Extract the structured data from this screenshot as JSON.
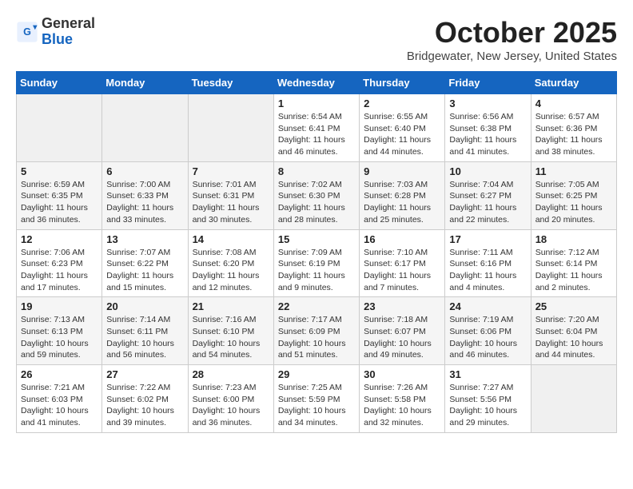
{
  "header": {
    "logo_general": "General",
    "logo_blue": "Blue",
    "month": "October 2025",
    "location": "Bridgewater, New Jersey, United States"
  },
  "weekdays": [
    "Sunday",
    "Monday",
    "Tuesday",
    "Wednesday",
    "Thursday",
    "Friday",
    "Saturday"
  ],
  "weeks": [
    [
      {
        "day": "",
        "info": ""
      },
      {
        "day": "",
        "info": ""
      },
      {
        "day": "",
        "info": ""
      },
      {
        "day": "1",
        "info": "Sunrise: 6:54 AM\nSunset: 6:41 PM\nDaylight: 11 hours\nand 46 minutes."
      },
      {
        "day": "2",
        "info": "Sunrise: 6:55 AM\nSunset: 6:40 PM\nDaylight: 11 hours\nand 44 minutes."
      },
      {
        "day": "3",
        "info": "Sunrise: 6:56 AM\nSunset: 6:38 PM\nDaylight: 11 hours\nand 41 minutes."
      },
      {
        "day": "4",
        "info": "Sunrise: 6:57 AM\nSunset: 6:36 PM\nDaylight: 11 hours\nand 38 minutes."
      }
    ],
    [
      {
        "day": "5",
        "info": "Sunrise: 6:59 AM\nSunset: 6:35 PM\nDaylight: 11 hours\nand 36 minutes."
      },
      {
        "day": "6",
        "info": "Sunrise: 7:00 AM\nSunset: 6:33 PM\nDaylight: 11 hours\nand 33 minutes."
      },
      {
        "day": "7",
        "info": "Sunrise: 7:01 AM\nSunset: 6:31 PM\nDaylight: 11 hours\nand 30 minutes."
      },
      {
        "day": "8",
        "info": "Sunrise: 7:02 AM\nSunset: 6:30 PM\nDaylight: 11 hours\nand 28 minutes."
      },
      {
        "day": "9",
        "info": "Sunrise: 7:03 AM\nSunset: 6:28 PM\nDaylight: 11 hours\nand 25 minutes."
      },
      {
        "day": "10",
        "info": "Sunrise: 7:04 AM\nSunset: 6:27 PM\nDaylight: 11 hours\nand 22 minutes."
      },
      {
        "day": "11",
        "info": "Sunrise: 7:05 AM\nSunset: 6:25 PM\nDaylight: 11 hours\nand 20 minutes."
      }
    ],
    [
      {
        "day": "12",
        "info": "Sunrise: 7:06 AM\nSunset: 6:23 PM\nDaylight: 11 hours\nand 17 minutes."
      },
      {
        "day": "13",
        "info": "Sunrise: 7:07 AM\nSunset: 6:22 PM\nDaylight: 11 hours\nand 15 minutes."
      },
      {
        "day": "14",
        "info": "Sunrise: 7:08 AM\nSunset: 6:20 PM\nDaylight: 11 hours\nand 12 minutes."
      },
      {
        "day": "15",
        "info": "Sunrise: 7:09 AM\nSunset: 6:19 PM\nDaylight: 11 hours\nand 9 minutes."
      },
      {
        "day": "16",
        "info": "Sunrise: 7:10 AM\nSunset: 6:17 PM\nDaylight: 11 hours\nand 7 minutes."
      },
      {
        "day": "17",
        "info": "Sunrise: 7:11 AM\nSunset: 6:16 PM\nDaylight: 11 hours\nand 4 minutes."
      },
      {
        "day": "18",
        "info": "Sunrise: 7:12 AM\nSunset: 6:14 PM\nDaylight: 11 hours\nand 2 minutes."
      }
    ],
    [
      {
        "day": "19",
        "info": "Sunrise: 7:13 AM\nSunset: 6:13 PM\nDaylight: 10 hours\nand 59 minutes."
      },
      {
        "day": "20",
        "info": "Sunrise: 7:14 AM\nSunset: 6:11 PM\nDaylight: 10 hours\nand 56 minutes."
      },
      {
        "day": "21",
        "info": "Sunrise: 7:16 AM\nSunset: 6:10 PM\nDaylight: 10 hours\nand 54 minutes."
      },
      {
        "day": "22",
        "info": "Sunrise: 7:17 AM\nSunset: 6:09 PM\nDaylight: 10 hours\nand 51 minutes."
      },
      {
        "day": "23",
        "info": "Sunrise: 7:18 AM\nSunset: 6:07 PM\nDaylight: 10 hours\nand 49 minutes."
      },
      {
        "day": "24",
        "info": "Sunrise: 7:19 AM\nSunset: 6:06 PM\nDaylight: 10 hours\nand 46 minutes."
      },
      {
        "day": "25",
        "info": "Sunrise: 7:20 AM\nSunset: 6:04 PM\nDaylight: 10 hours\nand 44 minutes."
      }
    ],
    [
      {
        "day": "26",
        "info": "Sunrise: 7:21 AM\nSunset: 6:03 PM\nDaylight: 10 hours\nand 41 minutes."
      },
      {
        "day": "27",
        "info": "Sunrise: 7:22 AM\nSunset: 6:02 PM\nDaylight: 10 hours\nand 39 minutes."
      },
      {
        "day": "28",
        "info": "Sunrise: 7:23 AM\nSunset: 6:00 PM\nDaylight: 10 hours\nand 36 minutes."
      },
      {
        "day": "29",
        "info": "Sunrise: 7:25 AM\nSunset: 5:59 PM\nDaylight: 10 hours\nand 34 minutes."
      },
      {
        "day": "30",
        "info": "Sunrise: 7:26 AM\nSunset: 5:58 PM\nDaylight: 10 hours\nand 32 minutes."
      },
      {
        "day": "31",
        "info": "Sunrise: 7:27 AM\nSunset: 5:56 PM\nDaylight: 10 hours\nand 29 minutes."
      },
      {
        "day": "",
        "info": ""
      }
    ]
  ]
}
